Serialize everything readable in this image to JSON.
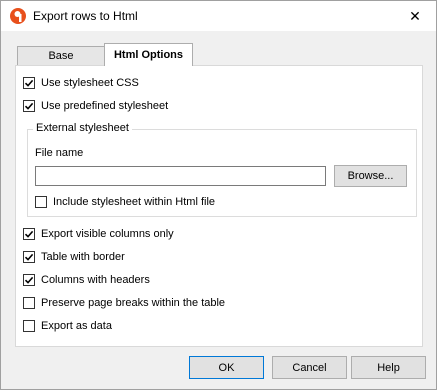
{
  "window": {
    "title": "Export rows to Html",
    "close_glyph": "✕"
  },
  "tabs": [
    {
      "label": "Base",
      "active": false
    },
    {
      "label": "Html Options",
      "active": true
    }
  ],
  "options_top": [
    {
      "label": "Use stylesheet CSS",
      "checked": true
    },
    {
      "label": "Use predefined stylesheet",
      "checked": true
    }
  ],
  "external": {
    "group_label": "External stylesheet",
    "file_name_label": "File name",
    "file_name_value": "",
    "browse_label": "Browse...",
    "include_label": "Include stylesheet within Html file",
    "include_checked": false
  },
  "options_bottom": [
    {
      "label": "Export visible columns only",
      "checked": true
    },
    {
      "label": "Table with border",
      "checked": true
    },
    {
      "label": "Columns with headers",
      "checked": true
    },
    {
      "label": "Preserve page breaks within the table",
      "checked": false
    },
    {
      "label": "Export as data",
      "checked": false
    }
  ],
  "buttons": {
    "ok": "OK",
    "cancel": "Cancel",
    "help": "Help"
  },
  "colors": {
    "accent": "#0078d7",
    "app_icon": "#e8501c"
  },
  "icons": {
    "app": "app-logo-icon",
    "close": "close-icon",
    "check": "checkmark-icon"
  }
}
